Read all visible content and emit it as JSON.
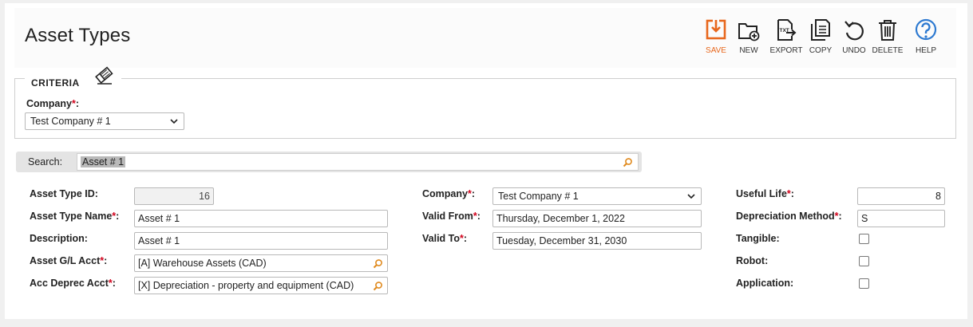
{
  "header": {
    "title": "Asset Types"
  },
  "toolbar": {
    "save": "SAVE",
    "new": "NEW",
    "export": "EXPORT",
    "copy": "COPY",
    "undo": "UNDO",
    "delete": "DELETE",
    "help": "HELP",
    "export_badge": "TXT"
  },
  "criteria": {
    "title": "CRITERIA",
    "company_label": "Company",
    "required_mark": "*",
    "colon": ":",
    "company_value": "Test Company # 1"
  },
  "search": {
    "label": "Search:",
    "value": "Asset # 1"
  },
  "form": {
    "asset_type_id_label": "Asset Type ID:",
    "asset_type_id": "16",
    "asset_type_name_label": "Asset Type Name",
    "asset_type_name": "Asset # 1",
    "description_label": "Description:",
    "description": "Asset # 1",
    "asset_gl_acct_label": "Asset G/L Acct",
    "asset_gl_acct": "[A] Warehouse Assets (CAD)",
    "acc_deprec_acct_label": "Acc Deprec Acct",
    "acc_deprec_acct": "[X] Depreciation - property and equipment (CAD)",
    "company_label": "Company",
    "company": "Test Company # 1",
    "valid_from_label": "Valid From",
    "valid_from": "Thursday, December 1, 2022",
    "valid_to_label": "Valid To",
    "valid_to": "Tuesday, December 31, 2030",
    "useful_life_label": "Useful Life",
    "useful_life": "8",
    "depreciation_method_label": "Depreciation Method",
    "depreciation_method": "S",
    "tangible_label": "Tangible:",
    "robot_label": "Robot:",
    "application_label": "Application:"
  },
  "colors": {
    "accent": "#e8671c",
    "help": "#2e7ad1",
    "required": "#d0021b"
  }
}
